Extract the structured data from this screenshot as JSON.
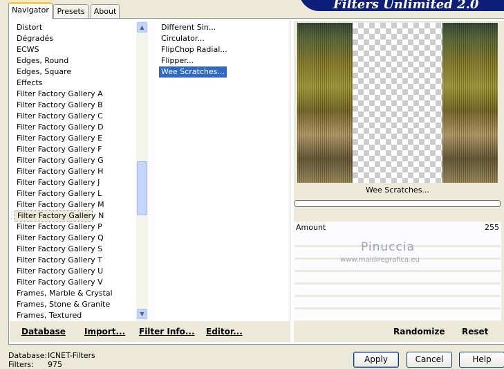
{
  "header": {
    "title": "Filters Unlimited 2.0"
  },
  "tabs": [
    {
      "label": "Navigator"
    },
    {
      "label": "Presets"
    },
    {
      "label": "About"
    }
  ],
  "categories": [
    "Distort",
    "Dégradés",
    "ECWS",
    "Edges, Round",
    "Edges, Square",
    "Effects",
    "Filter Factory Gallery A",
    "Filter Factory Gallery B",
    "Filter Factory Gallery C",
    "Filter Factory Gallery D",
    "Filter Factory Gallery E",
    "Filter Factory Gallery F",
    "Filter Factory Gallery G",
    "Filter Factory Gallery H",
    "Filter Factory Gallery J",
    "Filter Factory Gallery L",
    "Filter Factory Gallery M",
    "Filter Factory Gallery N",
    "Filter Factory Gallery P",
    "Filter Factory Gallery Q",
    "Filter Factory Gallery S",
    "Filter Factory Gallery T",
    "Filter Factory Gallery U",
    "Filter Factory Gallery V",
    "Frames, Marble & Crystal",
    "Frames, Stone & Granite",
    "Frames, Textured"
  ],
  "filters": [
    " Different Sin...",
    "Circulator...",
    "FlipChop Radial...",
    "Flipper...",
    "Wee Scratches..."
  ],
  "left_buttons": {
    "database": "Database",
    "import": "Import...",
    "filter_info": "Filter Info...",
    "editor": "Editor..."
  },
  "preview": {
    "filter_name": "Wee Scratches..."
  },
  "params": {
    "amount_label": "Amount",
    "amount_value": "255"
  },
  "watermark": {
    "name": "Pinuccia",
    "url": "www.maidiregrafica.eu"
  },
  "right_buttons": {
    "randomize": "Randomize",
    "reset": "Reset"
  },
  "status": {
    "database_label": "Database:",
    "database_value": "ICNET-Filters",
    "filters_label": "Filters:",
    "filters_value": "975"
  },
  "dialog_buttons": {
    "apply": "Apply",
    "cancel": "Cancel",
    "help": "Help"
  }
}
